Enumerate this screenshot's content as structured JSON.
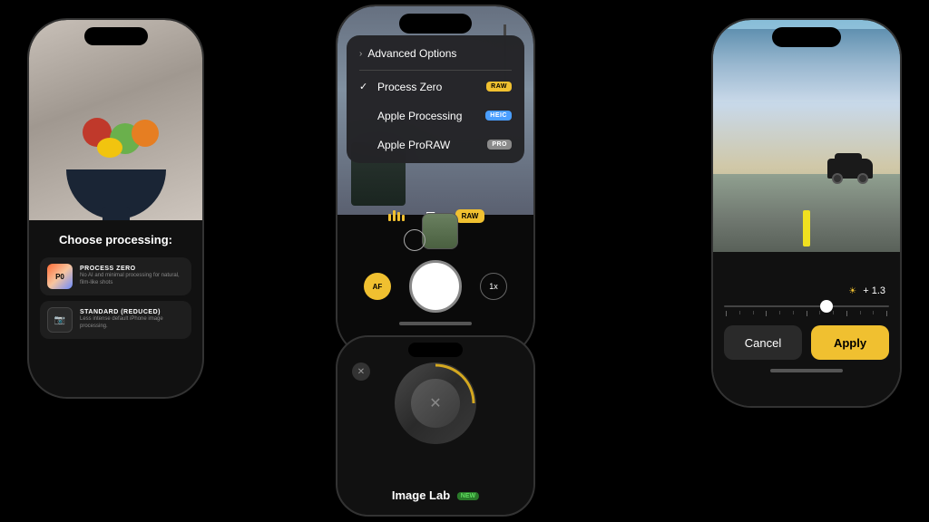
{
  "page": {
    "background": "#000"
  },
  "phone1": {
    "choose_processing": "Choose processing:",
    "option1_name": "PROCESS ZERO",
    "option1_desc": "No AI and minimal processing for natural, film-like shots",
    "option2_name": "STANDARD (REDUCED)",
    "option2_desc": "Less intense default iPhone image processing."
  },
  "phone2": {
    "menu": {
      "advanced_options": "Advanced Options",
      "process_zero": "Process Zero",
      "apple_processing": "Apple Processing",
      "apple_proraw": "Apple ProRAW"
    },
    "badges": {
      "raw": "RAW",
      "heic": "HEIC",
      "pro": "PRO"
    },
    "zoom": "1x",
    "af": "AF"
  },
  "phone3": {
    "label": "Image Lab",
    "new_badge": "NEW"
  },
  "phone4": {
    "exposure": "+ 1.3",
    "cancel": "Cancel",
    "apply": "Apply"
  }
}
